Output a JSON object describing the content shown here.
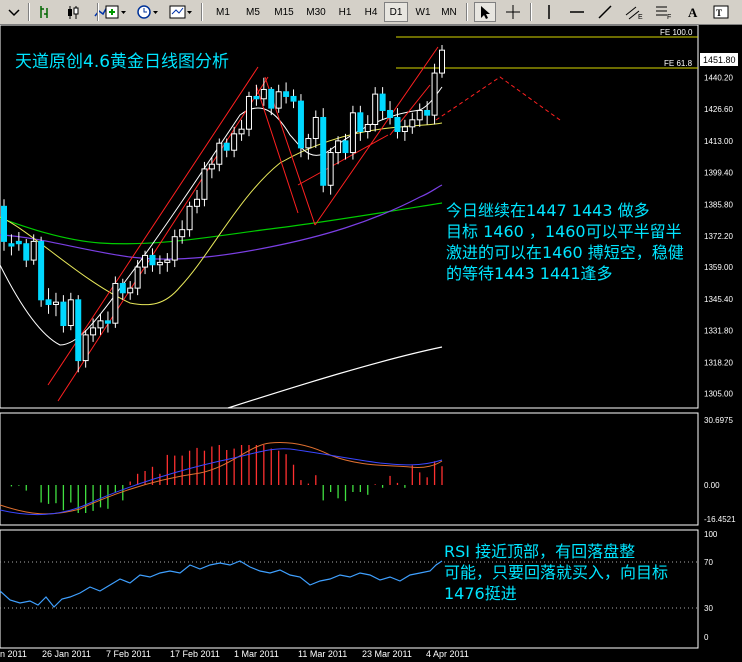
{
  "toolbar": {
    "timeframes": [
      "M1",
      "M5",
      "M15",
      "M30",
      "H1",
      "H4",
      "D1",
      "W1",
      "MN"
    ],
    "active_timeframe": "D1"
  },
  "main_panel": {
    "title": "天道原创4.6黄金日线图分析",
    "fib_labels": [
      "FE 100.0",
      "FE 61.8"
    ],
    "current_price": "1451.80",
    "price_ticks": [
      "1440.20",
      "1426.60",
      "1413.00",
      "1399.40",
      "1385.80",
      "1372.20",
      "1359.00",
      "1345.40",
      "1331.80",
      "1318.20",
      "1305.00"
    ],
    "annotation_lines": [
      "今日继续在1447   1443 做多",
      "目标 1460 ，1460可以平半留半",
      "激进的可以在1460 搏短空，稳健",
      "的等待1443   1441逢多"
    ]
  },
  "macd_panel": {
    "ticks": [
      "30.6975",
      "0.00",
      "-16.4521"
    ]
  },
  "rsi_panel": {
    "ticks": [
      "100",
      "70",
      "30",
      "0"
    ],
    "annotation_lines": [
      "RSI  接近顶部，有回落盘整",
      "可能，只要回落就买入，向目标",
      "1476挺进"
    ]
  },
  "date_axis": [
    "n 2011",
    "26 Jan 2011",
    "7 Feb 2011",
    "17 Feb 2011",
    "1 Mar 2011",
    "11 Mar 2011",
    "23 Mar 2011",
    "4 Apr 2011"
  ],
  "chart_data": {
    "type": "candlestick",
    "x": [
      "13 Jan",
      "14 Jan",
      "17 Jan",
      "18 Jan",
      "19 Jan",
      "20 Jan",
      "21 Jan",
      "24 Jan",
      "25 Jan",
      "26 Jan",
      "27 Jan",
      "28 Jan",
      "31 Jan",
      "1 Feb",
      "2 Feb",
      "3 Feb",
      "4 Feb",
      "7 Feb",
      "8 Feb",
      "9 Feb",
      "10 Feb",
      "11 Feb",
      "14 Feb",
      "15 Feb",
      "16 Feb",
      "17 Feb",
      "18 Feb",
      "21 Feb",
      "22 Feb",
      "23 Feb",
      "24 Feb",
      "25 Feb",
      "28 Feb",
      "1 Mar",
      "2 Mar",
      "3 Mar",
      "4 Mar",
      "7 Mar",
      "8 Mar",
      "9 Mar",
      "10 Mar",
      "11 Mar",
      "14 Mar",
      "15 Mar",
      "16 Mar",
      "17 Mar",
      "18 Mar",
      "21 Mar",
      "22 Mar",
      "23 Mar",
      "24 Mar",
      "25 Mar",
      "28 Mar",
      "29 Mar",
      "30 Mar",
      "31 Mar",
      "1 Apr",
      "4 Apr",
      "5 Apr",
      "6 Apr"
    ],
    "open": [
      1385,
      1369,
      1370,
      1369,
      1362,
      1370,
      1345,
      1343,
      1344,
      1334,
      1345,
      1319,
      1330,
      1333,
      1336,
      1335,
      1352,
      1348,
      1350,
      1359,
      1364,
      1360,
      1361,
      1362,
      1372,
      1375,
      1385,
      1388,
      1401,
      1403,
      1412,
      1409,
      1416,
      1418,
      1432,
      1431,
      1435,
      1427,
      1434,
      1432,
      1430,
      1410,
      1414,
      1423,
      1394,
      1408,
      1413,
      1408,
      1425,
      1417,
      1420,
      1433,
      1426,
      1423,
      1417,
      1419,
      1422,
      1426,
      1424,
      1442
    ],
    "close": [
      1370,
      1368,
      1369,
      1362,
      1370,
      1345,
      1343,
      1344,
      1334,
      1345,
      1319,
      1330,
      1333,
      1336,
      1335,
      1352,
      1348,
      1350,
      1359,
      1364,
      1360,
      1361,
      1362,
      1372,
      1375,
      1385,
      1388,
      1401,
      1403,
      1412,
      1409,
      1416,
      1418,
      1432,
      1431,
      1435,
      1427,
      1434,
      1432,
      1430,
      1410,
      1414,
      1423,
      1394,
      1408,
      1413,
      1408,
      1425,
      1417,
      1420,
      1433,
      1426,
      1423,
      1417,
      1419,
      1422,
      1426,
      1424,
      1442,
      1451.8
    ],
    "high": [
      1388,
      1373,
      1374,
      1371,
      1373,
      1372,
      1350,
      1348,
      1347,
      1348,
      1347,
      1332,
      1337,
      1339,
      1340,
      1355,
      1354,
      1353,
      1362,
      1366,
      1367,
      1364,
      1365,
      1375,
      1379,
      1387,
      1392,
      1404,
      1406,
      1414,
      1414,
      1419,
      1422,
      1434,
      1437,
      1440,
      1436,
      1437,
      1438,
      1435,
      1433,
      1416,
      1426,
      1427,
      1410,
      1415,
      1416,
      1428,
      1428,
      1424,
      1436,
      1436,
      1430,
      1427,
      1422,
      1425,
      1429,
      1430,
      1446,
      1454
    ],
    "low": [
      1366,
      1364,
      1366,
      1359,
      1360,
      1342,
      1339,
      1338,
      1331,
      1332,
      1314,
      1316,
      1327,
      1330,
      1331,
      1333,
      1345,
      1345,
      1347,
      1356,
      1357,
      1356,
      1357,
      1359,
      1369,
      1372,
      1382,
      1385,
      1397,
      1400,
      1406,
      1406,
      1413,
      1415,
      1428,
      1428,
      1424,
      1425,
      1429,
      1427,
      1406,
      1405,
      1410,
      1391,
      1390,
      1403,
      1405,
      1405,
      1413,
      1414,
      1417,
      1422,
      1420,
      1414,
      1413,
      1416,
      1419,
      1420,
      1420,
      1440
    ],
    "ylim": [
      1300,
      1460
    ]
  }
}
